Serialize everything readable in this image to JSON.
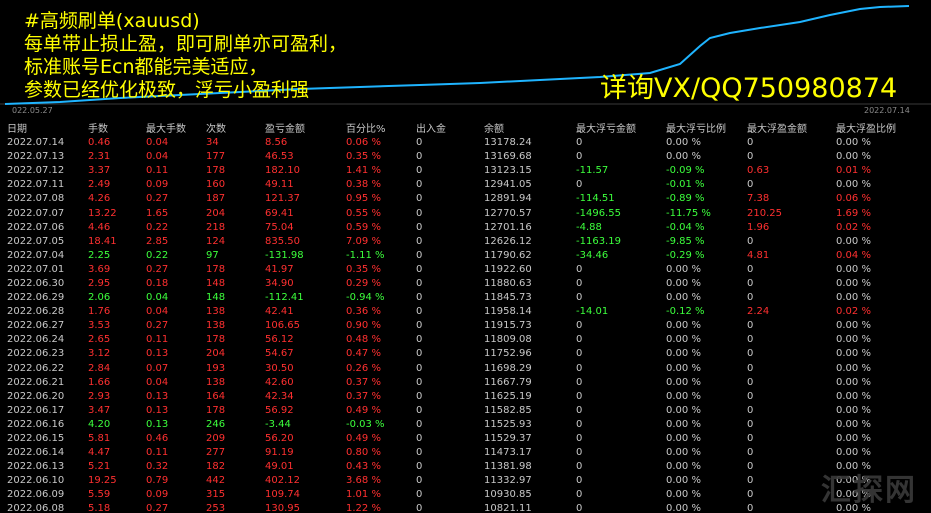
{
  "overlay": {
    "lines": [
      "#高频刷单(xauusd)",
      "每单带止损止盈，即可刷单亦可盈利，",
      "标准账号Ecn都能完美适应，",
      "参数已经优化极致，浮亏小盈利强"
    ],
    "contact": "详询VX/QQ750980874"
  },
  "chart": {
    "start_date": "022.05.27",
    "end_date": "2022.07.14",
    "line_color": "#1fb4ff"
  },
  "table": {
    "headers": [
      "日期",
      "手数",
      "最大手数",
      "次数",
      "盈亏金额",
      "百分比%",
      "出入金",
      "余额",
      "最大浮亏金额",
      "最大浮亏比例",
      "最大浮盈金额",
      "最大浮盈比例"
    ],
    "rows": [
      [
        "2022.07.14",
        "0.46",
        "0.04",
        "34",
        "8.56",
        "0.06 %",
        "0",
        "13178.24",
        "0",
        "0.00 %",
        "0",
        "0.00 %"
      ],
      [
        "2022.07.13",
        "2.31",
        "0.04",
        "177",
        "46.53",
        "0.35 %",
        "0",
        "13169.68",
        "0",
        "0.00 %",
        "0",
        "0.00 %"
      ],
      [
        "2022.07.12",
        "3.37",
        "0.11",
        "178",
        "182.10",
        "1.41 %",
        "0",
        "13123.15",
        "-11.57",
        "-0.09 %",
        "0.63",
        "0.01 %"
      ],
      [
        "2022.07.11",
        "2.49",
        "0.09",
        "160",
        "49.11",
        "0.38 %",
        "0",
        "12941.05",
        "0",
        "-0.01 %",
        "0",
        "0.00 %"
      ],
      [
        "2022.07.08",
        "4.26",
        "0.27",
        "187",
        "121.37",
        "0.95 %",
        "0",
        "12891.94",
        "-114.51",
        "-0.89 %",
        "7.38",
        "0.06 %"
      ],
      [
        "2022.07.07",
        "13.22",
        "1.65",
        "204",
        "69.41",
        "0.55 %",
        "0",
        "12770.57",
        "-1496.55",
        "-11.75 %",
        "210.25",
        "1.69 %"
      ],
      [
        "2022.07.06",
        "4.46",
        "0.22",
        "218",
        "75.04",
        "0.59 %",
        "0",
        "12701.16",
        "-4.88",
        "-0.04 %",
        "1.96",
        "0.02 %"
      ],
      [
        "2022.07.05",
        "18.41",
        "2.85",
        "124",
        "835.50",
        "7.09 %",
        "0",
        "12626.12",
        "-1163.19",
        "-9.85 %",
        "0",
        "0.00 %"
      ],
      [
        "2022.07.04",
        "2.25",
        "0.22",
        "97",
        "-131.98",
        "-1.11 %",
        "0",
        "11790.62",
        "-34.46",
        "-0.29 %",
        "4.81",
        "0.04 %"
      ],
      [
        "2022.07.01",
        "3.69",
        "0.27",
        "178",
        "41.97",
        "0.35 %",
        "0",
        "11922.60",
        "0",
        "0.00 %",
        "0",
        "0.00 %"
      ],
      [
        "2022.06.30",
        "2.95",
        "0.18",
        "148",
        "34.90",
        "0.29 %",
        "0",
        "11880.63",
        "0",
        "0.00 %",
        "0",
        "0.00 %"
      ],
      [
        "2022.06.29",
        "2.06",
        "0.04",
        "148",
        "-112.41",
        "-0.94 %",
        "0",
        "11845.73",
        "0",
        "0.00 %",
        "0",
        "0.00 %"
      ],
      [
        "2022.06.28",
        "1.76",
        "0.04",
        "138",
        "42.41",
        "0.36 %",
        "0",
        "11958.14",
        "-14.01",
        "-0.12 %",
        "2.24",
        "0.02 %"
      ],
      [
        "2022.06.27",
        "3.53",
        "0.27",
        "138",
        "106.65",
        "0.90 %",
        "0",
        "11915.73",
        "0",
        "0.00 %",
        "0",
        "0.00 %"
      ],
      [
        "2022.06.24",
        "2.65",
        "0.11",
        "178",
        "56.12",
        "0.48 %",
        "0",
        "11809.08",
        "0",
        "0.00 %",
        "0",
        "0.00 %"
      ],
      [
        "2022.06.23",
        "3.12",
        "0.13",
        "204",
        "54.67",
        "0.47 %",
        "0",
        "11752.96",
        "0",
        "0.00 %",
        "0",
        "0.00 %"
      ],
      [
        "2022.06.22",
        "2.84",
        "0.07",
        "193",
        "30.50",
        "0.26 %",
        "0",
        "11698.29",
        "0",
        "0.00 %",
        "0",
        "0.00 %"
      ],
      [
        "2022.06.21",
        "1.66",
        "0.04",
        "138",
        "42.60",
        "0.37 %",
        "0",
        "11667.79",
        "0",
        "0.00 %",
        "0",
        "0.00 %"
      ],
      [
        "2022.06.20",
        "2.93",
        "0.13",
        "164",
        "42.34",
        "0.37 %",
        "0",
        "11625.19",
        "0",
        "0.00 %",
        "0",
        "0.00 %"
      ],
      [
        "2022.06.17",
        "3.47",
        "0.13",
        "178",
        "56.92",
        "0.49 %",
        "0",
        "11582.85",
        "0",
        "0.00 %",
        "0",
        "0.00 %"
      ],
      [
        "2022.06.16",
        "4.20",
        "0.13",
        "246",
        "-3.44",
        "-0.03 %",
        "0",
        "11525.93",
        "0",
        "0.00 %",
        "0",
        "0.00 %"
      ],
      [
        "2022.06.15",
        "5.81",
        "0.46",
        "209",
        "56.20",
        "0.49 %",
        "0",
        "11529.37",
        "0",
        "0.00 %",
        "0",
        "0.00 %"
      ],
      [
        "2022.06.14",
        "4.47",
        "0.11",
        "277",
        "91.19",
        "0.80 %",
        "0",
        "11473.17",
        "0",
        "0.00 %",
        "0",
        "0.00 %"
      ],
      [
        "2022.06.13",
        "5.21",
        "0.32",
        "182",
        "49.01",
        "0.43 %",
        "0",
        "11381.98",
        "0",
        "0.00 %",
        "0",
        "0.00 %"
      ],
      [
        "2022.06.10",
        "19.25",
        "0.79",
        "442",
        "402.12",
        "3.68 %",
        "0",
        "11332.97",
        "0",
        "0.00 %",
        "0",
        "0.00 %"
      ],
      [
        "2022.06.09",
        "5.59",
        "0.09",
        "315",
        "109.74",
        "1.01 %",
        "0",
        "10930.85",
        "0",
        "0.00 %",
        "0",
        "0.00 %"
      ],
      [
        "2022.06.08",
        "5.18",
        "0.27",
        "253",
        "130.95",
        "1.22 %",
        "0",
        "10821.11",
        "0",
        "0.00 %",
        "0",
        "0.00 %"
      ]
    ]
  },
  "watermark": "汇探网"
}
